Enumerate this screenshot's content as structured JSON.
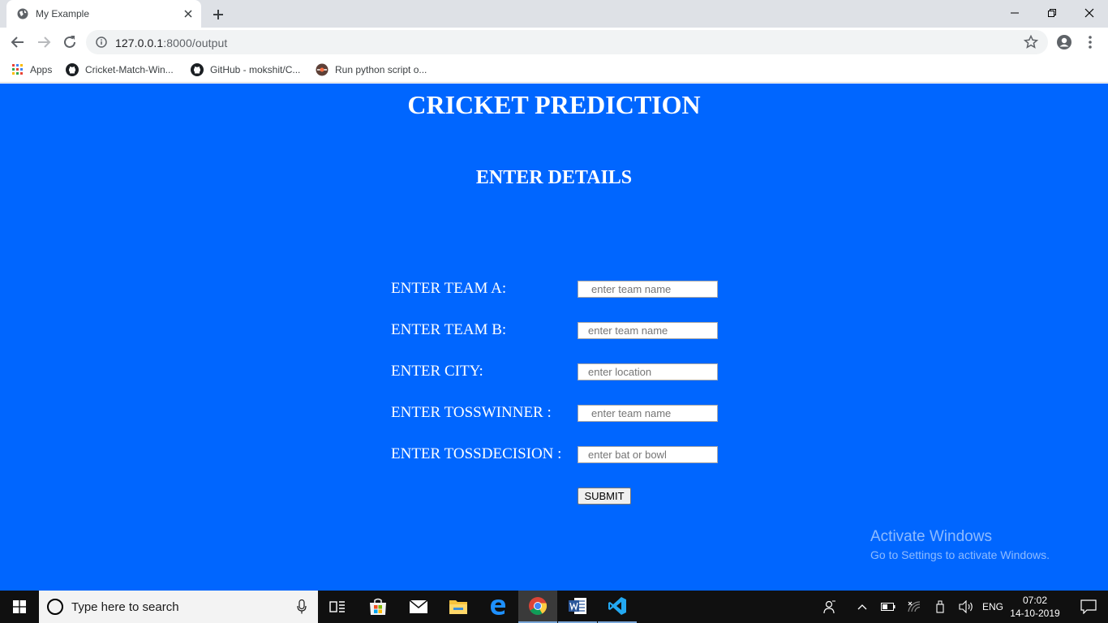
{
  "browser": {
    "tab_title": "My Example",
    "url_host": "127.0.0.1",
    "url_rest": ":8000/output",
    "bookmarks": [
      {
        "label": "Apps"
      },
      {
        "label": "Cricket-Match-Win..."
      },
      {
        "label": "GitHub - mokshit/C..."
      },
      {
        "label": "Run python script o..."
      }
    ]
  },
  "page": {
    "title": "CRICKET PREDICTION",
    "subtitle": "ENTER DETAILS",
    "fields": [
      {
        "label": "ENTER TEAM A:",
        "placeholder": "enter team name"
      },
      {
        "label": "ENTER TEAM B:",
        "placeholder": "enter team name"
      },
      {
        "label": "ENTER CITY:",
        "placeholder": "enter location"
      },
      {
        "label": "ENTER TOSSWINNER :",
        "placeholder": "enter team name"
      },
      {
        "label": "ENTER TOSSDECISION :",
        "placeholder": "enter bat or bowl"
      }
    ],
    "submit_label": "SUBMIT",
    "background_color": "#0066ff"
  },
  "watermark": {
    "line1": "Activate Windows",
    "line2": "Go to Settings to activate Windows."
  },
  "taskbar": {
    "search_placeholder": "Type here to search",
    "language": "ENG",
    "time": "07:02",
    "date": "14-10-2019"
  }
}
